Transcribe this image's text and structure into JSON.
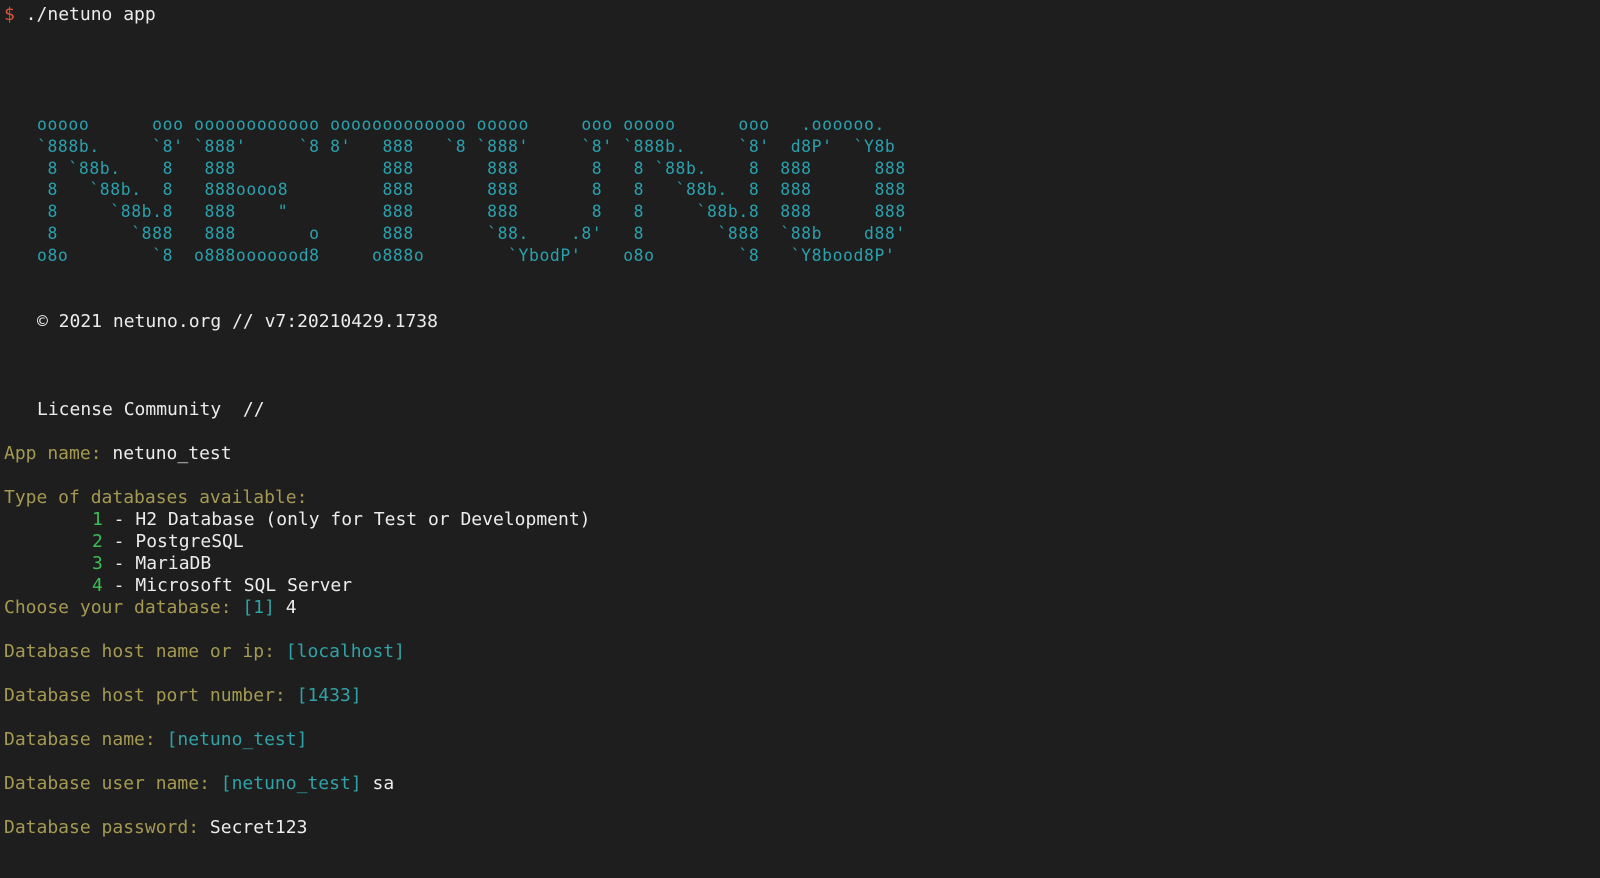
{
  "theme": {
    "background": "#1e1e1e",
    "text": "#ececec",
    "prompt": "#d9553f",
    "label": "#a49a52",
    "default": "#2fa3a7",
    "option_number": "#3bbf55",
    "banner": "#2aa1ad"
  },
  "shell": {
    "prompt": "$",
    "command": " ./netuno app"
  },
  "banner": {
    "ascii": "ooooo      ooo oooooooooooo ooooooooooooo ooooo     ooo ooooo      ooo   .oooooo.\n`888b.     `8' `888'     `8 8'   888   `8 `888'     `8' `888b.     `8'  d8P'  `Y8b\n 8 `88b.    8   888              888       888       8   8 `88b.    8  888      888\n 8   `88b.  8   888oooo8         888       888       8   8   `88b.  8  888      888\n 8     `88b.8   888    \"         888       888       8   8     `88b.8  888      888\n 8       `888   888       o      888       `88.    .8'   8       `888  `88b    d88'\no8o        `8  o888ooooood8     o888o        `YbodP'    o8o        `8   `Y8bood8P'"
  },
  "copyright": "© 2021 netuno.org // v7:20210429.1738",
  "license": "License Community  //",
  "prompts": {
    "app_name": {
      "label": "App name: ",
      "value": "netuno_test"
    },
    "db_types": {
      "label": "Type of databases available:",
      "options": [
        {
          "num": "1",
          "text": " - H2 Database (only for Test or Development)"
        },
        {
          "num": "2",
          "text": " - PostgreSQL"
        },
        {
          "num": "3",
          "text": " - MariaDB"
        },
        {
          "num": "4",
          "text": " - Microsoft SQL Server"
        }
      ]
    },
    "choose_db": {
      "label": "Choose your database: ",
      "default": "[1]",
      "value": " 4"
    },
    "db_host": {
      "label": "Database host name or ip: ",
      "default": "[localhost]",
      "value": ""
    },
    "db_port": {
      "label": "Database host port number: ",
      "default": "[1433]",
      "value": ""
    },
    "db_name": {
      "label": "Database name: ",
      "default": "[netuno_test]",
      "value": ""
    },
    "db_user": {
      "label": "Database user name: ",
      "default": "[netuno_test]",
      "value": " sa"
    },
    "db_password": {
      "label": "Database password: ",
      "value": "Secret123"
    }
  }
}
